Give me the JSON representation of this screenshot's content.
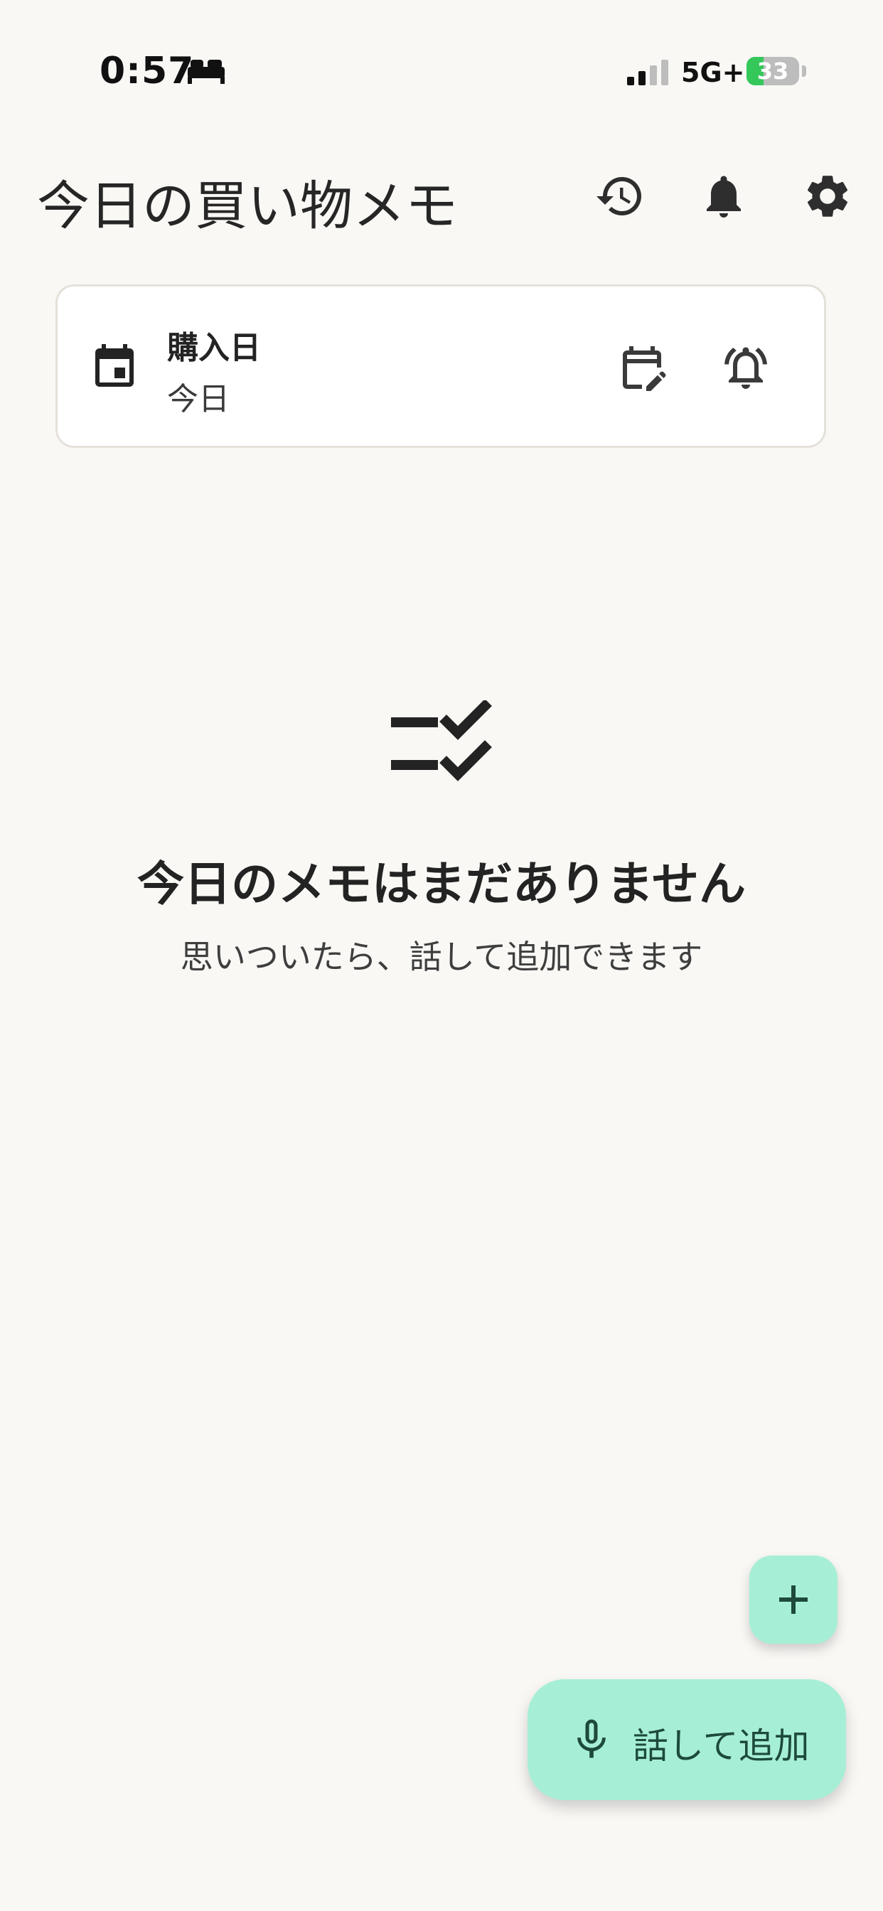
{
  "status_bar": {
    "time": "0:57",
    "network": "5G+",
    "battery_level": "33",
    "sleep_icon": "bed-icon",
    "signal_icon": "cellular-signal-icon"
  },
  "header": {
    "title": "今日の買い物メモ",
    "icons": [
      "history-icon",
      "bell-icon",
      "gear-icon"
    ]
  },
  "date_card": {
    "label": "購入日",
    "value": "今日",
    "icons": [
      "calendar-icon",
      "edit-calendar-icon",
      "alarm-bell-icon"
    ]
  },
  "empty_state": {
    "icon": "checklist-icon",
    "title": "今日のメモはまだありません",
    "subtitle": "思いついたら、話して追加できます"
  },
  "fab": {
    "add_icon": "plus-icon",
    "voice_label": "話して追加",
    "voice_icon": "microphone-icon"
  },
  "colors": {
    "background": "#F9F8F5",
    "card_border": "#E4E1DA",
    "fab_background": "#A6EFD6",
    "fab_text": "#1D4A3B",
    "battery_fill": "#34C759"
  }
}
